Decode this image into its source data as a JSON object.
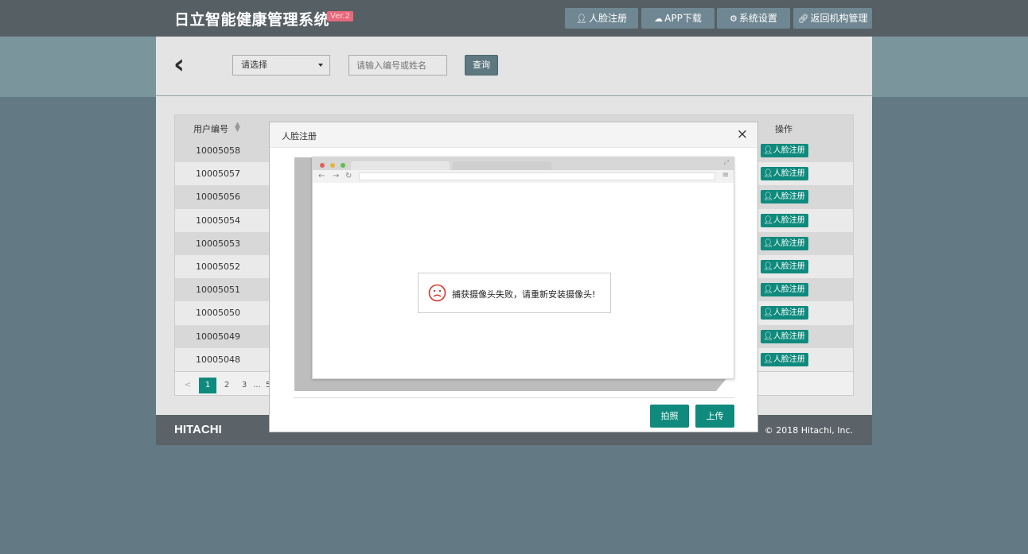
{
  "header": {
    "title": "日立智能健康管理系统",
    "version": "Ver.2",
    "nav": [
      {
        "label": "人脸注册",
        "icon": "user-icon"
      },
      {
        "label": "APP下载",
        "icon": "cloud-download-icon"
      },
      {
        "label": "系统设置",
        "icon": "gear-icon"
      },
      {
        "label": "返回机构管理",
        "icon": "link-icon"
      }
    ]
  },
  "toolbar": {
    "back_icon": "chevron-left-icon",
    "select_value": "请选择",
    "search_placeholder": "请输入编号或姓名",
    "query_label": "查询"
  },
  "table": {
    "columns": {
      "id": "用户编号",
      "operation": "操作"
    },
    "rows": [
      {
        "id": "10005058",
        "action": "人脸注册"
      },
      {
        "id": "10005057",
        "action": "人脸注册"
      },
      {
        "id": "10005056",
        "action": "人脸注册"
      },
      {
        "id": "10005054",
        "action": "人脸注册"
      },
      {
        "id": "10005053",
        "action": "人脸注册"
      },
      {
        "id": "10005052",
        "action": "人脸注册"
      },
      {
        "id": "10005051",
        "action": "人脸注册"
      },
      {
        "id": "10005050",
        "action": "人脸注册"
      },
      {
        "id": "10005049",
        "action": "人脸注册"
      },
      {
        "id": "10005048",
        "action": "人脸注册"
      }
    ],
    "pager": {
      "prev": "<",
      "pages": [
        "1",
        "2",
        "3"
      ],
      "ellipsis": "...",
      "last": "5",
      "current": "1"
    }
  },
  "footer": {
    "logo": "HITACHI",
    "copyright": "© 2018 Hitachi, Inc."
  },
  "modal": {
    "title": "人脸注册",
    "close": "×",
    "error_message": "捕获摄像头失败，请重新安装摄像头!",
    "capture_label": "拍照",
    "upload_label": "上传"
  },
  "colors": {
    "header_bg": "#565f64",
    "accent": "#0f8a7d",
    "version_badge": "#e8697b",
    "nav_button": "#6f8792"
  }
}
